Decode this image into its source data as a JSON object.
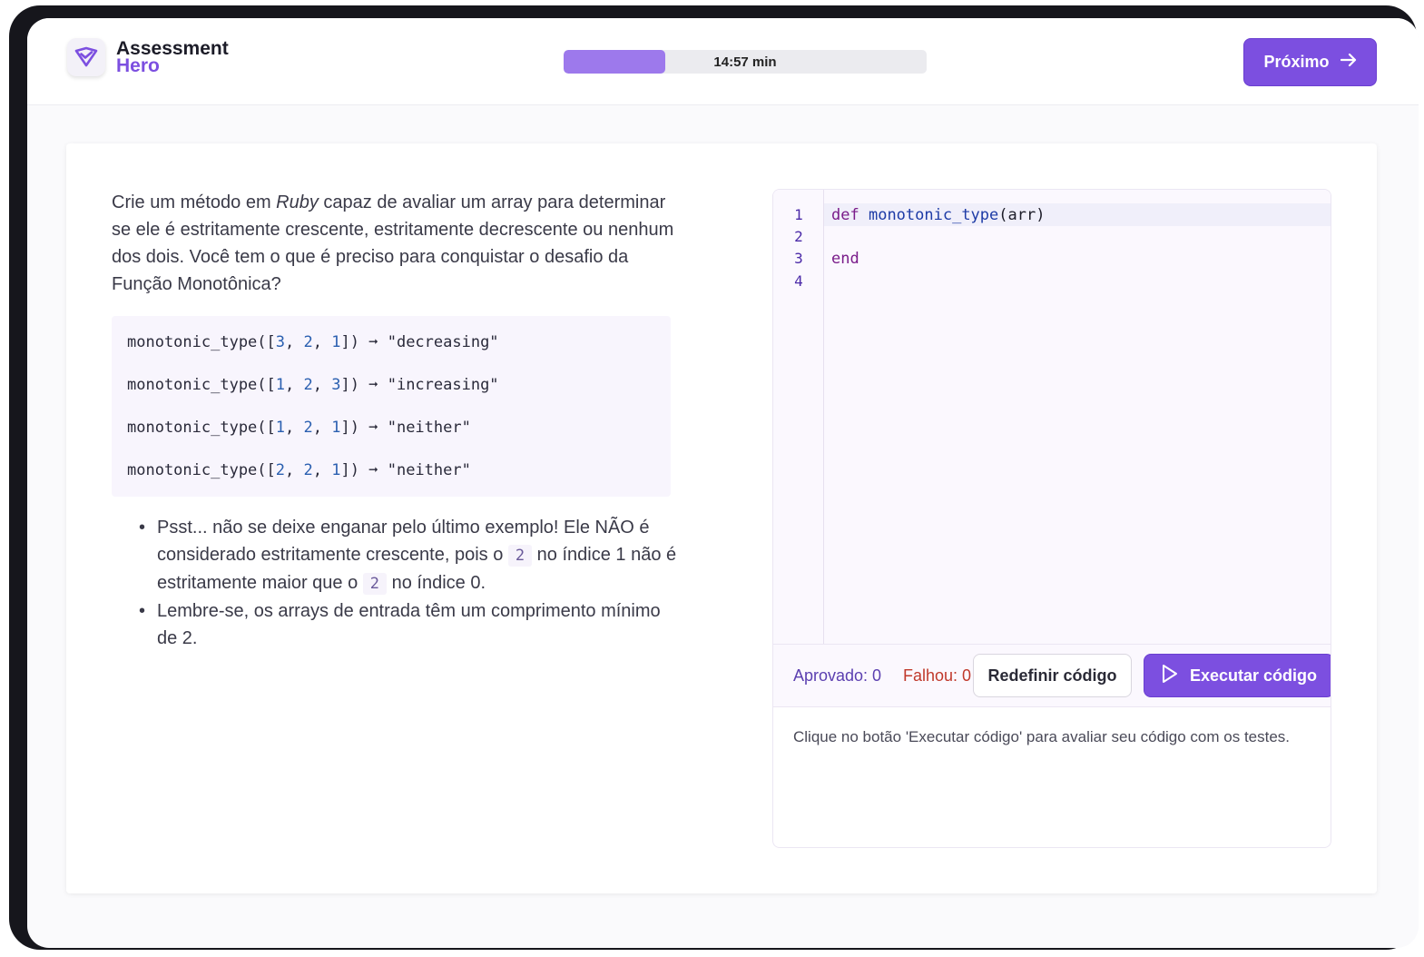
{
  "brand": {
    "name_line1": "Assessment",
    "name_line2": "Hero",
    "accent_color": "#7c4fe0",
    "icon": "check-shield-icon"
  },
  "header": {
    "timer_label": "14:57 min",
    "progress_fraction": 0.28,
    "next_button_label": "Próximo",
    "next_icon": "arrow-right-icon"
  },
  "question": {
    "prompt_before": "Crie um método em ",
    "prompt_language": "Ruby",
    "prompt_after": " capaz de avaliar um array para determinar se ele é estritamente crescente, estritamente decrescente ou nenhum dos dois. Você tem o que é preciso para conquistar o desafio da Função Monotônica?",
    "examples": [
      {
        "call": "monotonic_type",
        "args": [
          "3",
          "2",
          "1"
        ],
        "arrow": "➞",
        "result": "\"decreasing\""
      },
      {
        "call": "monotonic_type",
        "args": [
          "1",
          "2",
          "3"
        ],
        "arrow": "➞",
        "result": "\"increasing\""
      },
      {
        "call": "monotonic_type",
        "args": [
          "1",
          "2",
          "1"
        ],
        "arrow": "➞",
        "result": "\"neither\""
      },
      {
        "call": "monotonic_type",
        "args": [
          "2",
          "2",
          "1"
        ],
        "arrow": "➞",
        "result": "\"neither\""
      }
    ],
    "notes": {
      "note1_part1": "Psst... não se deixe enganar pelo último exemplo! Ele NÃO é considerado estritamente crescente, pois o ",
      "note1_code1": "2",
      "note1_part2": " no índice 1 não é estritamente maior que o ",
      "note1_code2": "2",
      "note1_part3": " no índice 0.",
      "note2": "Lembre-se, os arrays de entrada têm um comprimento mínimo de 2."
    }
  },
  "editor": {
    "line_numbers": [
      "1",
      "2",
      "3",
      "4"
    ],
    "line1_keyword": "def",
    "line1_function": "monotonic_type",
    "line1_params": "(arr)",
    "line3_keyword": "end"
  },
  "tests": {
    "passed_label": "Aprovado: 0",
    "failed_label": "Falhou: 0",
    "reset_button_label": "Redefinir código",
    "run_button_label": "Executar código",
    "run_icon": "play-icon",
    "output_message": "Clique no botão 'Executar código' para avaliar seu código com os testes."
  }
}
